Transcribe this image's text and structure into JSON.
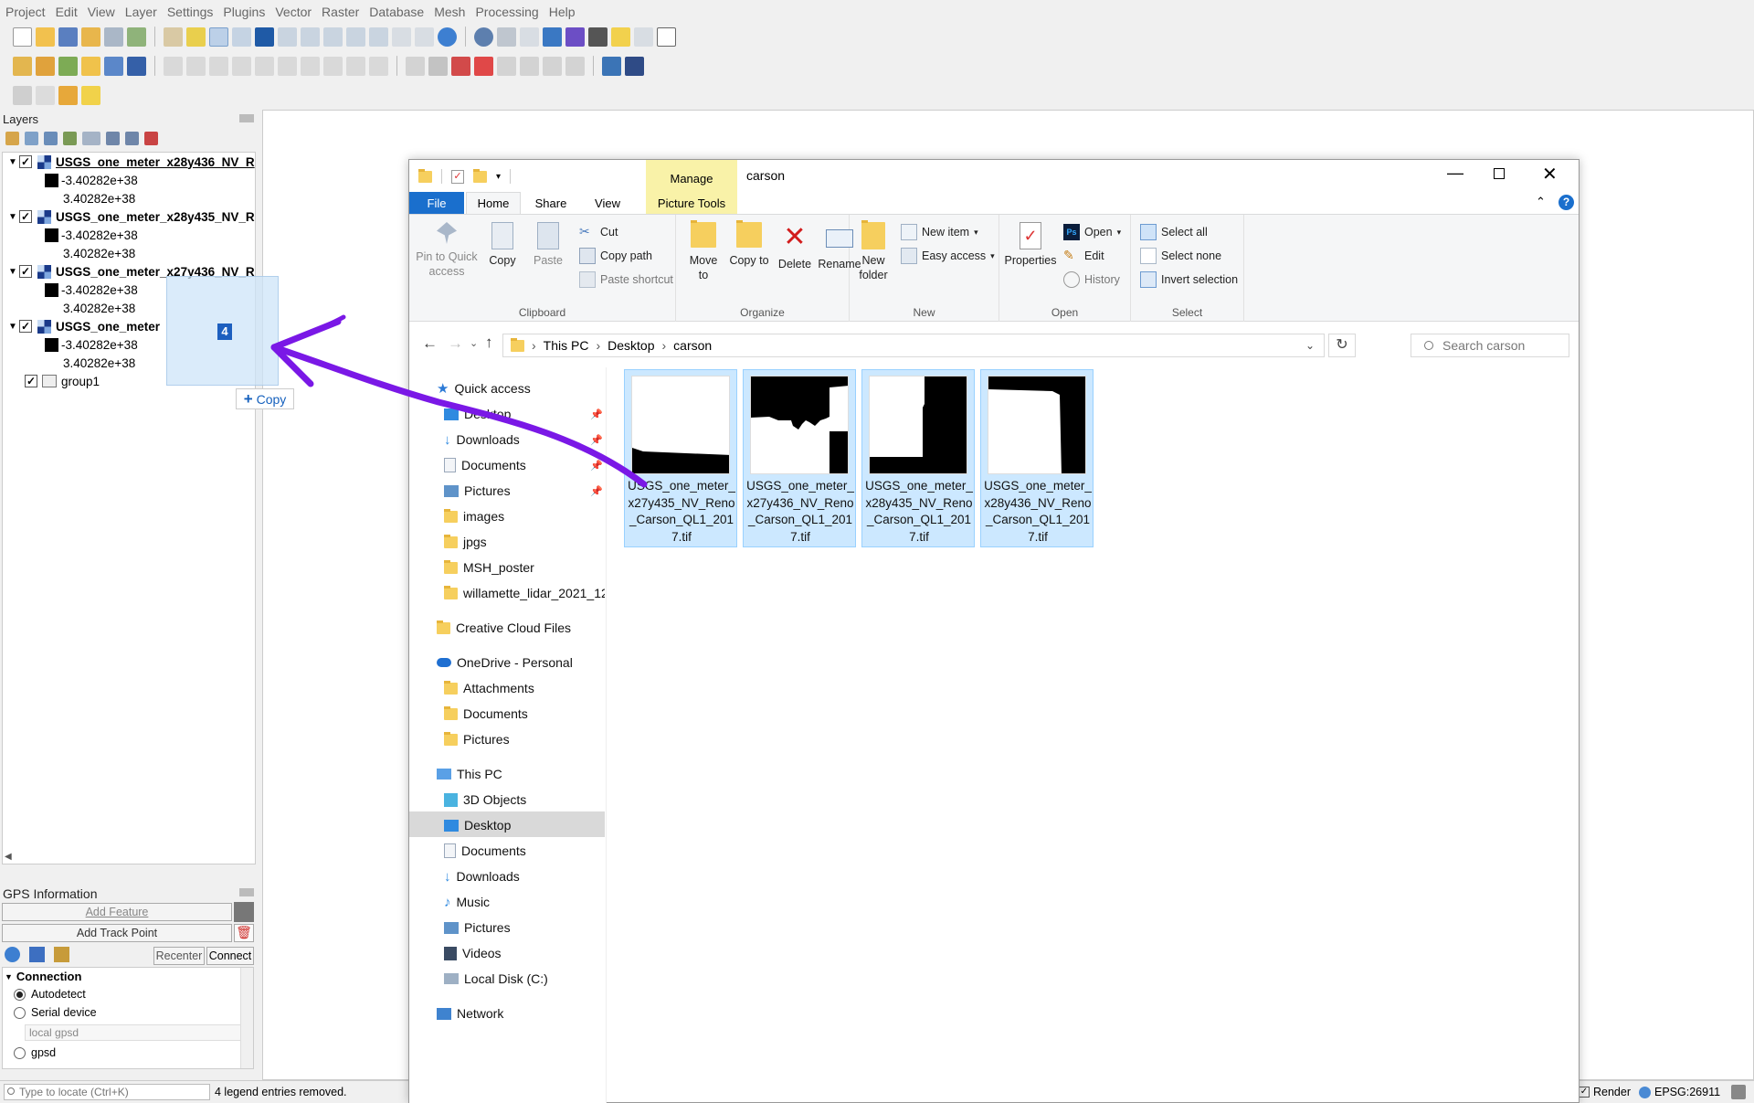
{
  "qgis": {
    "menu": [
      "Project",
      "Edit",
      "View",
      "Layer",
      "Settings",
      "Plugins",
      "Vector",
      "Raster",
      "Database",
      "Mesh",
      "Processing",
      "Help"
    ],
    "layers_panel": {
      "title": "Layers",
      "layers": [
        {
          "name": "USGS_one_meter_x28y436_NV_R",
          "min": "-3.40282e+38",
          "max": "3.40282e+38"
        },
        {
          "name": "USGS_one_meter_x28y435_NV_R",
          "min": "-3.40282e+38",
          "max": "3.40282e+38"
        },
        {
          "name": "USGS_one_meter_x27y436_NV_R",
          "min": "-3.40282e+38",
          "max": "3.40282e+38"
        },
        {
          "name": "USGS_one_meter",
          "min": "-3.40282e+38",
          "max": "3.40282e+38"
        }
      ],
      "group": "group1"
    },
    "drag": {
      "count": "4",
      "copy_label": "Copy",
      "copy_sign": "+"
    },
    "gps": {
      "title": "GPS Information",
      "add_feature": "Add Feature",
      "add_track_point": "Add Track Point",
      "recenter": "Recenter",
      "connect": "Connect",
      "section": "Connection",
      "autodetect": "Autodetect",
      "serial": "Serial device",
      "local_gpsd": "local gpsd",
      "gpsd": "gpsd"
    },
    "status": {
      "locate_placeholder": "Type to locate (Ctrl+K)",
      "message": "4 legend entries removed.",
      "render": "Render",
      "crs": "EPSG:26911"
    }
  },
  "explorer": {
    "title": "carson",
    "manage_tab": "Manage",
    "tabs": [
      "File",
      "Home",
      "Share",
      "View",
      "Picture Tools"
    ],
    "clipboard": {
      "pin": "Pin to Quick access",
      "copy": "Copy",
      "paste": "Paste",
      "cut": "Cut",
      "copy_path": "Copy path",
      "paste_shortcut": "Paste shortcut",
      "label": "Clipboard"
    },
    "organize": {
      "move": "Move to",
      "copy": "Copy to",
      "delete": "Delete",
      "rename": "Rename",
      "label": "Organize"
    },
    "new": {
      "new_folder": "New folder",
      "new_item": "New item",
      "easy_access": "Easy access",
      "label": "New"
    },
    "open": {
      "properties": "Properties",
      "open": "Open",
      "edit": "Edit",
      "history": "History",
      "label": "Open"
    },
    "select": {
      "all": "Select all",
      "none": "Select none",
      "invert": "Invert selection",
      "label": "Select"
    },
    "breadcrumb": [
      "This PC",
      "Desktop",
      "carson"
    ],
    "search_placeholder": "Search carson",
    "nav": {
      "quick_access": "Quick access",
      "quick": [
        "Desktop",
        "Downloads",
        "Documents",
        "Pictures",
        "images",
        "jpgs",
        "MSH_poster",
        "willamette_lidar_2021_12"
      ],
      "creative": "Creative Cloud Files",
      "onedrive": "OneDrive - Personal",
      "onedrive_items": [
        "Attachments",
        "Documents",
        "Pictures"
      ],
      "this_pc": "This PC",
      "pc_items": [
        "3D Objects",
        "Desktop",
        "Documents",
        "Downloads",
        "Music",
        "Pictures",
        "Videos",
        "Local Disk (C:)"
      ],
      "network": "Network"
    },
    "files": [
      {
        "name": "USGS_one_meter_x27y435_NV_Reno_Carson_QL1_2017.tif"
      },
      {
        "name": "USGS_one_meter_x27y436_NV_Reno_Carson_QL1_2017.tif"
      },
      {
        "name": "USGS_one_meter_x28y435_NV_Reno_Carson_QL1_2017.tif"
      },
      {
        "name": "USGS_one_meter_x28y436_NV_Reno_Carson_QL1_2017.tif"
      }
    ]
  }
}
